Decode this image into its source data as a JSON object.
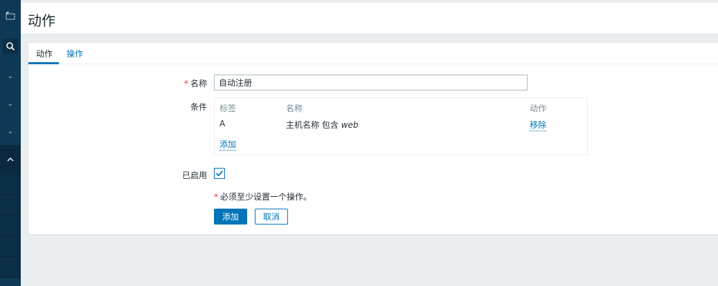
{
  "header": {
    "title": "动作"
  },
  "tabs": [
    {
      "label": "动作",
      "active": true
    },
    {
      "label": "操作",
      "active": false
    }
  ],
  "form": {
    "name_label": "名称",
    "name_value": "自动注册",
    "conditions_label": "条件",
    "conditions": {
      "headers": [
        "标签",
        "名称",
        "动作"
      ],
      "rows": [
        {
          "tag": "A",
          "name_prefix": "主机名称 包含 ",
          "name_value": "web",
          "action": "移除"
        }
      ],
      "add_link": "添加"
    },
    "enabled_label": "已启用",
    "enabled": true,
    "hint": "必须至少设置一个操作。",
    "add_button": "添加",
    "cancel_button": "取消"
  },
  "colors": {
    "accent": "#0275b8",
    "sidebar": "#0e3a56",
    "required": "#e33734"
  }
}
